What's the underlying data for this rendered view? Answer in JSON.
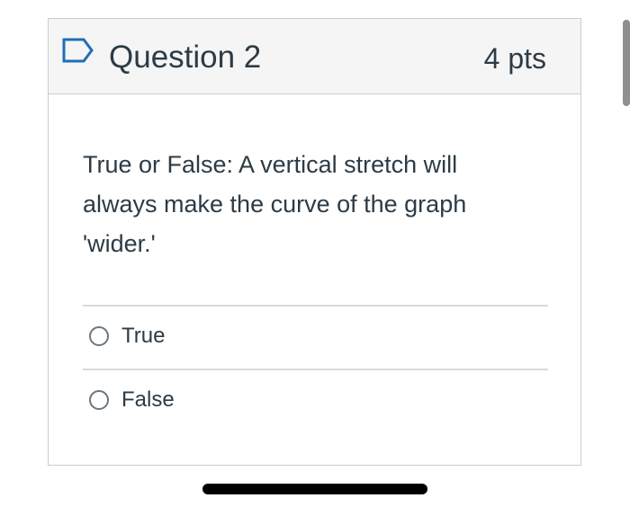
{
  "question": {
    "title": "Question 2",
    "points": "4 pts",
    "flag_icon": "bookmark-flag-icon",
    "text": "True or False: A vertical stretch will always make the curve of the graph 'wider.'",
    "answers": [
      {
        "label": "True",
        "selected": false
      },
      {
        "label": "False",
        "selected": false
      }
    ]
  },
  "colors": {
    "header_background": "#f5f5f5",
    "border": "#c7cdd1",
    "text": "#2d3b45",
    "flag": "#1f6fb8"
  }
}
